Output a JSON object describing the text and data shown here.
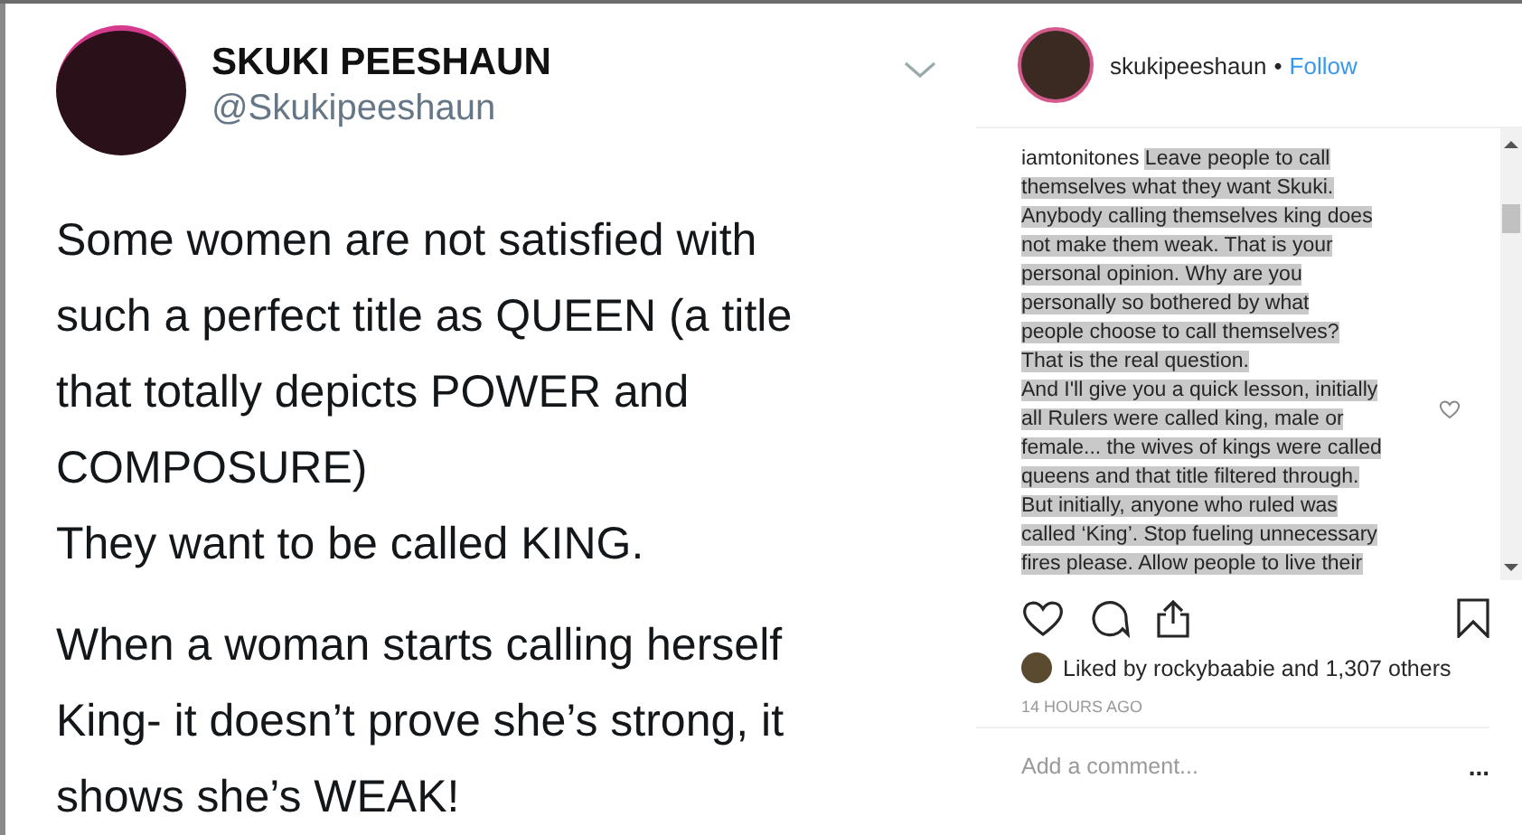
{
  "tweet": {
    "name": "SKUKI PEESHAUN",
    "handle": "@Skukipeeshaun",
    "paragraphs": [
      "Some women are not satisfied with\nsuch a perfect title as QUEEN (a title\nthat totally depicts POWER and\nCOMPOSURE)\nThey want to be called KING.",
      "When a woman starts calling herself\nKing- it doesn’t prove she’s strong, it\nshows she’s WEAK!"
    ]
  },
  "post": {
    "username": "skukipeeshaun",
    "separator": "•",
    "follow": "Follow",
    "comment": {
      "user": "iamtonitones",
      "text": "Leave people to call\nthemselves what they want Skuki.\nAnybody calling themselves king does\nnot make them weak. That is your\npersonal opinion. Why are you\npersonally so bothered by what\npeople choose to call themselves?\nThat is the real question.\nAnd I'll give you a quick lesson, initially\nall Rulers were called king, male or\nfemale... the wives of kings were called\nqueens and that title filtered through.\nBut initially, anyone who ruled was\ncalled ‘King’. Stop fueling unnecessary\nfires please. Allow people to live their"
    },
    "likes": "Liked by rockybaabie and 1,307 others",
    "time": "14 HOURS AGO",
    "comment_field": {
      "placeholder": "Add a comment..."
    },
    "more": "..."
  }
}
